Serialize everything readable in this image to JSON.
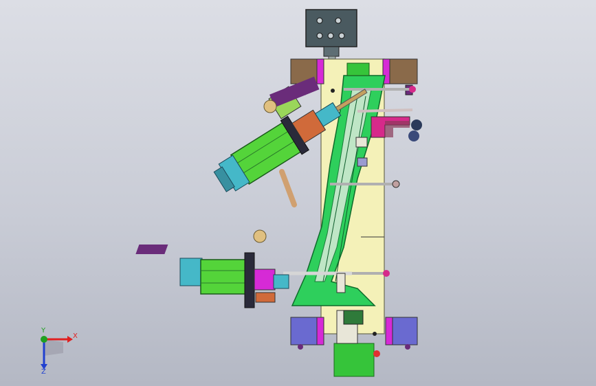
{
  "window": {
    "title": ""
  },
  "model": {
    "name": "",
    "colors": {
      "background_top": "#dcdee5",
      "background_bottom": "#b4b8c4",
      "base_plate": "#f4f1b8",
      "fixture_frame": "#2ecf5c",
      "motor_body": "#54d43a",
      "motor_endcap": "#45b8c8",
      "clamp_block": "#6a6ad0",
      "wood_block": "#8a6a4a",
      "magenta_bracket": "#d62ad6",
      "purple_bracket": "#6a2c7a",
      "green_base": "#36c43a",
      "top_plate": "#4a5a60"
    }
  },
  "triad": {
    "x_label": "X",
    "y_label": "Y",
    "z_label": "Z",
    "x_color": "#e02020",
    "y_color": "#20a020",
    "z_color": "#2040d0"
  }
}
